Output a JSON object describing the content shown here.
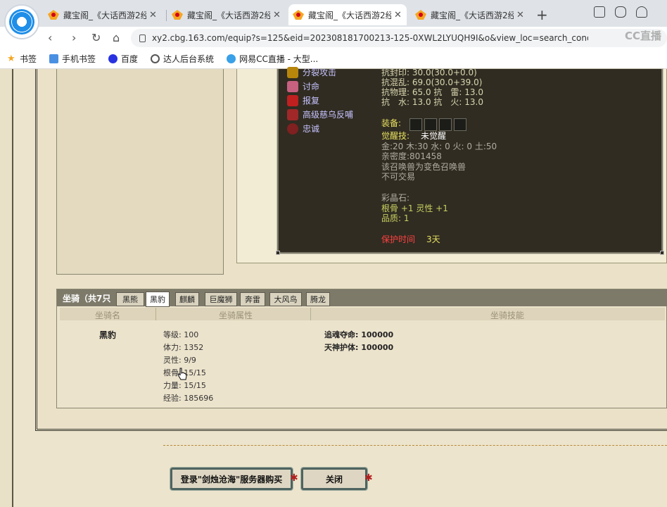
{
  "browser": {
    "tabs": [
      {
        "title": "藏宝阁_《大话西游2经典",
        "active": false
      },
      {
        "title": "藏宝阁_《大话西游2经典",
        "active": false
      },
      {
        "title": "藏宝阁_《大话西游2经典",
        "active": true
      },
      {
        "title": "藏宝阁_《大话西游2经典",
        "active": false
      }
    ],
    "url": "xy2.cbg.163.com/equip?s=125&eid=202308181700213-125-0XWL2LYUQH9I&o&view_loc=search_cond|%7B\"",
    "watermark": "CC直播",
    "bookmarks": [
      "书签",
      "手机书签",
      "百度",
      "达人后台系统",
      "网易CC直播 - 大型..."
    ]
  },
  "pet_panel": {
    "skills": [
      "分裂攻击",
      "讨命",
      "报复",
      "高级慈乌反哺",
      "忠诚"
    ],
    "resist_lines": [
      "抗封印: 30.0(30.0+0.0)",
      "抗混乱: 69.0(30.0+39.0)",
      "抗物理: 65.0 抗　雷: 13.0",
      "抗　水: 13.0 抗　火: 13.0"
    ],
    "equip_label": "装备:",
    "awaken_label": "觉醒技:",
    "awaken_value": "未觉醒",
    "elements": "金:20 木:30 水: 0 火: 0 土:50",
    "intimacy": "亲密度:801458",
    "variant_note": "该召唤兽为变色召唤兽",
    "no_trade": "不可交易",
    "crystal_label": "彩晶石:",
    "crystal_attrs": "根骨 +1 灵性 +1",
    "quality": "品质: 1",
    "protect_label": "保护时间",
    "protect_value": "3天"
  },
  "mounts": {
    "title": "坐骑（共7只",
    "tabs": [
      "黑熊",
      "黑豹",
      "麒麟",
      "巨魔狮",
      "奔雷",
      "大风鸟",
      "腾龙"
    ],
    "active_tab": 1,
    "col_name": "坐骑名",
    "col_attrs": "坐骑属性",
    "col_skills": "坐骑技能",
    "name": "黑豹",
    "attrs": [
      "等级: 100",
      "体力: 1352",
      "灵性: 9/9",
      "根骨: 15/15",
      "力量: 15/15",
      "经验: 185696"
    ],
    "skills": [
      "追魂夺命: 100000",
      "天神护体: 100000"
    ]
  },
  "buttons": {
    "login_buy": "登录\"剑烛沧海\"服务器购买",
    "close": "关闭"
  }
}
